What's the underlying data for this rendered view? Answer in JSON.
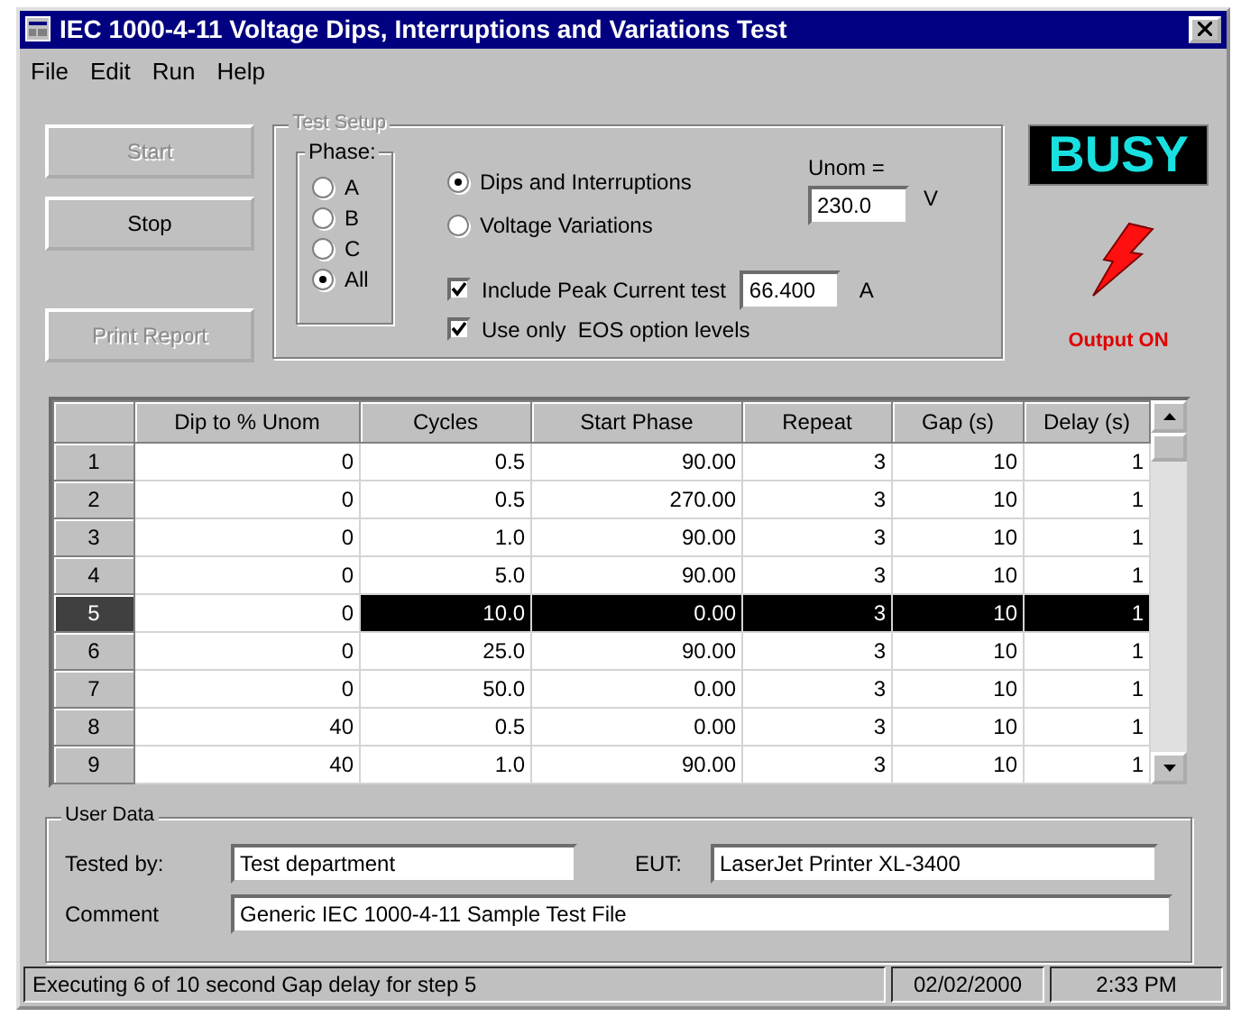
{
  "window": {
    "title": "IEC 1000-4-11 Voltage Dips, Interruptions and Variations Test"
  },
  "menu": [
    "File",
    "Edit",
    "Run",
    "Help"
  ],
  "buttons": [
    {
      "label": "Start",
      "disabled": true
    },
    {
      "label": "Stop",
      "disabled": false
    },
    {
      "label": "Print Report",
      "disabled": true
    }
  ],
  "test_setup": {
    "title": "Test Setup",
    "disabled": true,
    "phase": {
      "title": "Phase:",
      "options": [
        {
          "label": "A",
          "selected": false
        },
        {
          "label": "B",
          "selected": false
        },
        {
          "label": "C",
          "selected": false
        },
        {
          "label": "All",
          "selected": true
        }
      ]
    },
    "mode": [
      {
        "label": "Dips and Interruptions",
        "selected": true
      },
      {
        "label": "Voltage Variations",
        "selected": false
      }
    ],
    "unom_label": "Unom =",
    "unom_value": "230.0",
    "unom_unit": "V",
    "checks": [
      {
        "label": "Include Peak Current test",
        "checked": true
      },
      {
        "label": "Use only  EOS option levels",
        "checked": true
      }
    ],
    "peak_value": "66.400",
    "peak_unit": "A"
  },
  "status_display": {
    "text": "BUSY",
    "output_label": "Output ON"
  },
  "table": {
    "columns": [
      "Dip to % Unom",
      "Cycles",
      "Start Phase",
      "Repeat",
      "Gap (s)",
      "Delay (s)"
    ],
    "rows": [
      {
        "number": "1",
        "cells": [
          "0",
          "0.5",
          "90.00",
          "3",
          "10",
          "1"
        ],
        "selected": false
      },
      {
        "number": "2",
        "cells": [
          "0",
          "0.5",
          "270.00",
          "3",
          "10",
          "1"
        ],
        "selected": false
      },
      {
        "number": "3",
        "cells": [
          "0",
          "1.0",
          "90.00",
          "3",
          "10",
          "1"
        ],
        "selected": false
      },
      {
        "number": "4",
        "cells": [
          "0",
          "5.0",
          "90.00",
          "3",
          "10",
          "1"
        ],
        "selected": false
      },
      {
        "number": "5",
        "cells": [
          "0",
          "10.0",
          "0.00",
          "3",
          "10",
          "1"
        ],
        "selected": true
      },
      {
        "number": "6",
        "cells": [
          "0",
          "25.0",
          "90.00",
          "3",
          "10",
          "1"
        ],
        "selected": false
      },
      {
        "number": "7",
        "cells": [
          "0",
          "50.0",
          "0.00",
          "3",
          "10",
          "1"
        ],
        "selected": false
      },
      {
        "number": "8",
        "cells": [
          "40",
          "0.5",
          "0.00",
          "3",
          "10",
          "1"
        ],
        "selected": false
      },
      {
        "number": "9",
        "cells": [
          "40",
          "1.0",
          "90.00",
          "3",
          "10",
          "1"
        ],
        "selected": false
      }
    ]
  },
  "user_data": {
    "title": "User Data",
    "tested_by_label": "Tested by:",
    "tested_by": "Test department",
    "eut_label": "EUT:",
    "eut": "LaserJet Printer XL-3400",
    "comment_label": "Comment",
    "comment": "Generic IEC 1000-4-11 Sample Test File"
  },
  "status_bar": [
    "Executing 6 of 10 second Gap delay for step 5",
    "02/02/2000",
    "2:33 PM"
  ]
}
